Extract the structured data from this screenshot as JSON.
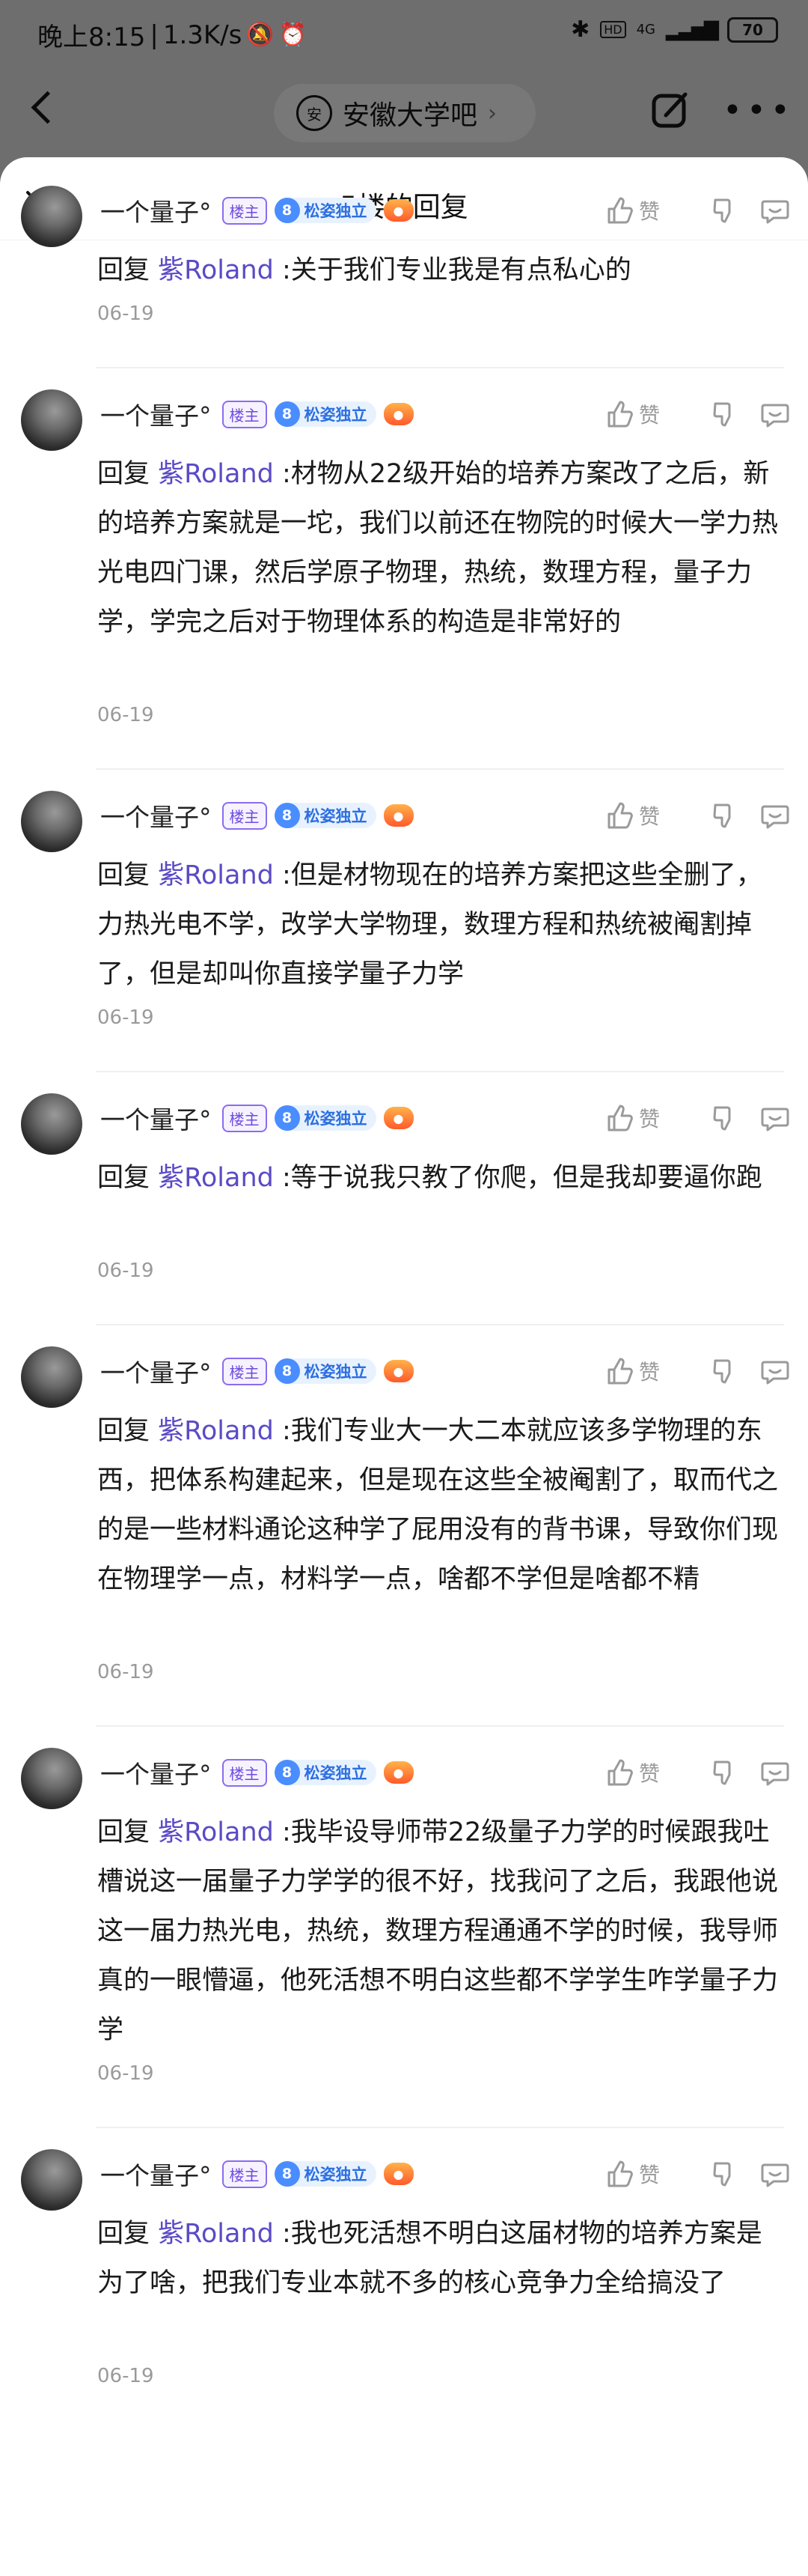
{
  "status_bar": {
    "time": "晚上8:15",
    "speed": "1.3K/s",
    "network": "4G",
    "battery": "70"
  },
  "nav": {
    "forum_name": "安徽大学吧",
    "forum_logo": "安"
  },
  "sheet": {
    "title": "5楼的回复"
  },
  "user": {
    "name": "一个量子°",
    "owner_badge": "楼主",
    "level": "8",
    "level_name": "松姿独立",
    "like_label": "赞"
  },
  "reply_prefix": "回复",
  "mention": "紫Roland",
  "replies": [
    {
      "text": ":关于我们专业我是有点私心的",
      "date": "06-19"
    },
    {
      "text": ":材物从22级开始的培养方案改了之后，新的培养方案就是一坨，我们以前还在物院的时候大一学力热光电四门课，然后学原子物理，热统，数理方程，量子力学，学完之后对于物理体系的构造是非常好的",
      "date": "06-19"
    },
    {
      "text": ":但是材物现在的培养方案把这些全删了，力热光电不学，改学大学物理，数理方程和热统被阉割掉了，但是却叫你直接学量子力学",
      "date": "06-19"
    },
    {
      "text": ":等于说我只教了你爬，但是我却要逼你跑",
      "date": "06-19"
    },
    {
      "text": ":我们专业大一大二本就应该多学物理的东西，把体系构建起来，但是现在这些全被阉割了，取而代之的是一些材料通论这种学了屁用没有的背书课，导致你们现在物理学一点，材料学一点，啥都不学但是啥都不精",
      "date": "06-19"
    },
    {
      "text": ":我毕设导师带22级量子力学的时候跟我吐槽说这一届量子力学学的很不好，找我问了之后，我跟他说这一届力热光电，热统，数理方程通通不学的时候，我导师真的一眼懵逼，他死活想不明白这些都不学学生咋学量子力学",
      "date": "06-19"
    },
    {
      "text": ":我也死活想不明白这届材物的培养方案是为了啥，把我们专业本就不多的核心竞争力全给搞没了",
      "date": "06-19"
    }
  ]
}
